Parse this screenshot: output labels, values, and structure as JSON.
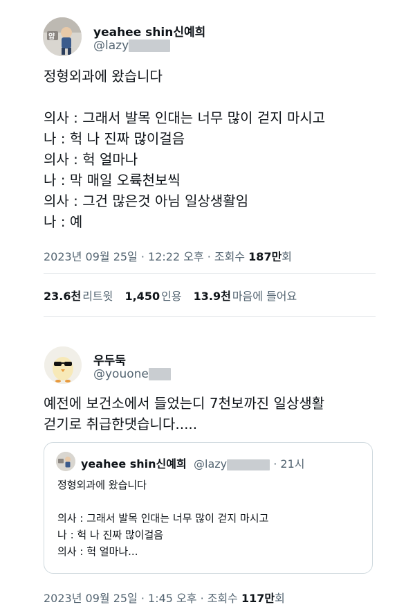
{
  "tweet": {
    "author_name": "yeahee shin신예희",
    "author_handle": "@lazy",
    "lines": [
      "정형외과에 왔습니다",
      "의사 : 그래서 발목 인대는 너무 많이 걷지 마시고",
      "나 : 헉 나 진짜 많이걸음",
      "의사 : 헉 얼마나",
      "나 : 막 매일 오륙천보씩",
      "의사 : 그건 많은것 아님 일상생활임",
      "나 : 예"
    ],
    "meta_prefix": "2023년 09월 25일 · 12:22 오후 · 조회수 ",
    "views": "187만",
    "views_suffix": "회",
    "stats": {
      "retweets": "23.6천",
      "retweets_label": "리트윗",
      "quotes": "1,450",
      "quotes_label": "인용",
      "likes": "13.9천",
      "likes_label": "마음에 들어요"
    }
  },
  "reply": {
    "author_name": "우두둑",
    "author_handle": "@youone",
    "lines": [
      "예전에 보건소에서 들었는디 7천보까진 일상생활",
      "걷기로 취급한댓습니다....."
    ],
    "quoted": {
      "author_name": "yeahee shin신예희",
      "author_handle": "@lazy",
      "time": "· 21시",
      "lines": [
        "정형외과에 왔습니다",
        "의사 : 그래서 발목 인대는 너무 많이 걷지 마시고",
        "나 : 헉 나 진짜 많이걸음",
        "의사 : 헉 얼마나..."
      ]
    },
    "meta_prefix": "2023년 09월 25일 · 1:45 오후 · 조회수 ",
    "views": "117만",
    "views_suffix": "회"
  },
  "colors": {
    "text": "#0f1419",
    "secondary": "#536471",
    "divider": "#e6e9ec",
    "redaction": "#c9cdd1"
  },
  "icons": {
    "author_avatar": "child-photo-avatar",
    "reply_avatar": "chick-with-sunglasses-avatar"
  }
}
